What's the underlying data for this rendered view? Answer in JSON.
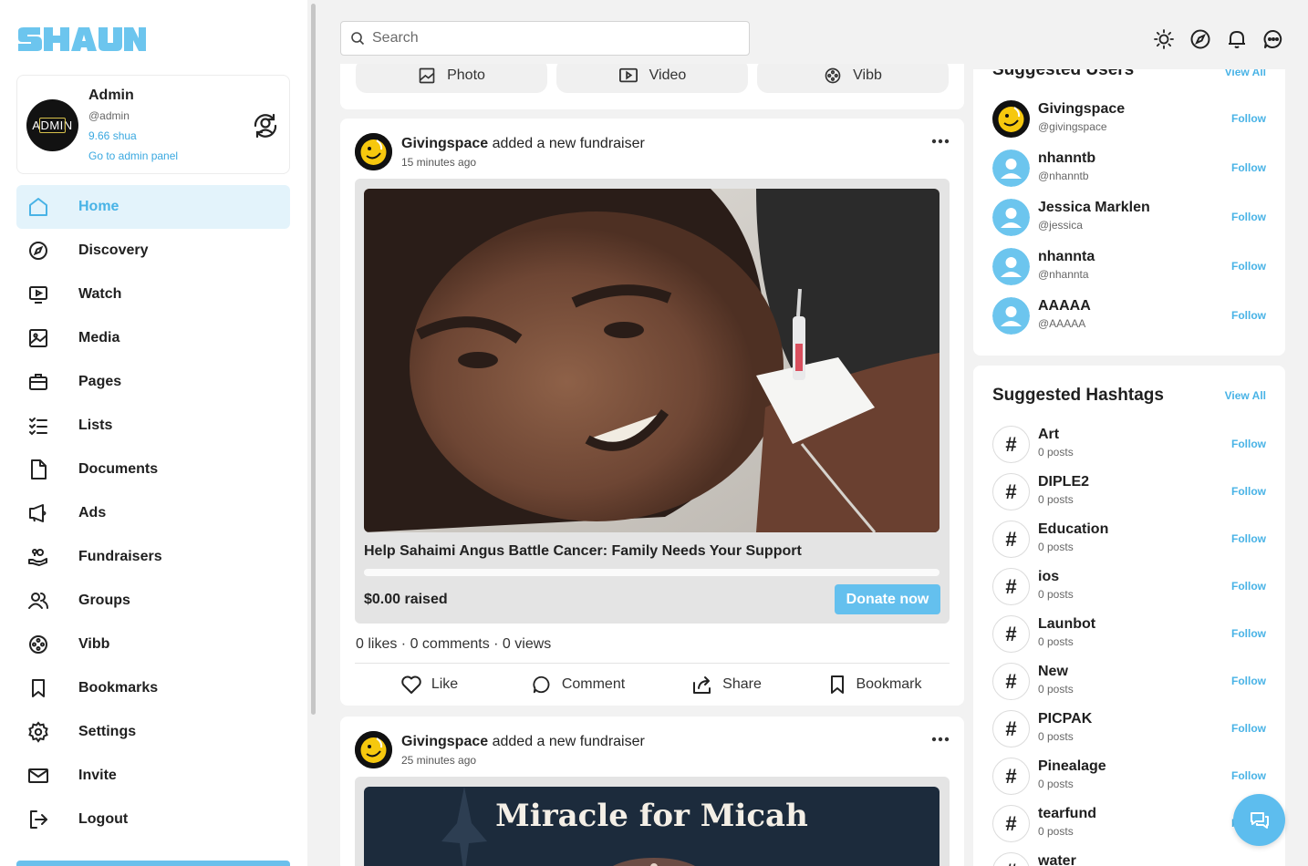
{
  "brand": {
    "logo_text": "SHAUN",
    "accent": "#49b3e6"
  },
  "profile": {
    "name": "Admin",
    "handle": "@admin",
    "balance": "9.66 shua",
    "admin_link": "Go to admin panel",
    "avatar_text": "ADMIN"
  },
  "nav": [
    {
      "label": "Home",
      "icon": "home-icon",
      "active": true
    },
    {
      "label": "Discovery",
      "icon": "compass-icon"
    },
    {
      "label": "Watch",
      "icon": "video-play-icon"
    },
    {
      "label": "Media",
      "icon": "image-icon"
    },
    {
      "label": "Pages",
      "icon": "briefcase-icon"
    },
    {
      "label": "Lists",
      "icon": "checklist-icon"
    },
    {
      "label": "Documents",
      "icon": "document-icon"
    },
    {
      "label": "Ads",
      "icon": "megaphone-icon"
    },
    {
      "label": "Fundraisers",
      "icon": "hand-coins-icon"
    },
    {
      "label": "Groups",
      "icon": "group-icon"
    },
    {
      "label": "Vibb",
      "icon": "film-reel-icon"
    },
    {
      "label": "Bookmarks",
      "icon": "bookmark-icon"
    },
    {
      "label": "Settings",
      "icon": "gear-icon"
    },
    {
      "label": "Invite",
      "icon": "mail-icon"
    },
    {
      "label": "Logout",
      "icon": "logout-icon"
    }
  ],
  "header": {
    "search_placeholder": "Search",
    "icons": [
      "sun-icon",
      "compass-icon",
      "bell-icon",
      "chat-icon"
    ]
  },
  "composer": {
    "photo": "Photo",
    "video": "Video",
    "vibb": "Vibb"
  },
  "posts": [
    {
      "author": "Givingspace",
      "action": "added a new fundraiser",
      "time": "15 minutes ago",
      "fundraiser_title": "Help Sahaimi Angus Battle Cancer: Family Needs Your Support",
      "raised": "$0.00 raised",
      "progress": 0,
      "donate": "Donate now",
      "stats": "0 likes · 0 comments · 0 views",
      "actions": {
        "like": "Like",
        "comment": "Comment",
        "share": "Share",
        "bookmark": "Bookmark"
      }
    },
    {
      "author": "Givingspace",
      "action": "added a new fundraiser",
      "time": "25 minutes ago",
      "banner_text": "Miracle for Micah"
    }
  ],
  "suggested_users": {
    "title": "Suggested Users",
    "view_all": "View All",
    "follow": "Follow",
    "items": [
      {
        "name": "Givingspace",
        "handle": "@givingspace"
      },
      {
        "name": "nhanntb",
        "handle": "@nhanntb"
      },
      {
        "name": "Jessica Marklen",
        "handle": "@jessica"
      },
      {
        "name": "nhannta",
        "handle": "@nhannta"
      },
      {
        "name": "AAAAA",
        "handle": "@AAAAA"
      }
    ]
  },
  "suggested_hashtags": {
    "title": "Suggested Hashtags",
    "view_all": "View All",
    "follow": "Follow",
    "items": [
      {
        "tag": "Art",
        "posts": "0 posts"
      },
      {
        "tag": "DIPLE2",
        "posts": "0 posts"
      },
      {
        "tag": "Education",
        "posts": "0 posts"
      },
      {
        "tag": "ios",
        "posts": "0 posts"
      },
      {
        "tag": "Launbot",
        "posts": "0 posts"
      },
      {
        "tag": "New",
        "posts": "0 posts"
      },
      {
        "tag": "PICPAK",
        "posts": "0 posts"
      },
      {
        "tag": "Pinealage",
        "posts": "0 posts"
      },
      {
        "tag": "tearfund",
        "posts": "0 posts"
      },
      {
        "tag": "water",
        "posts": ""
      }
    ]
  }
}
